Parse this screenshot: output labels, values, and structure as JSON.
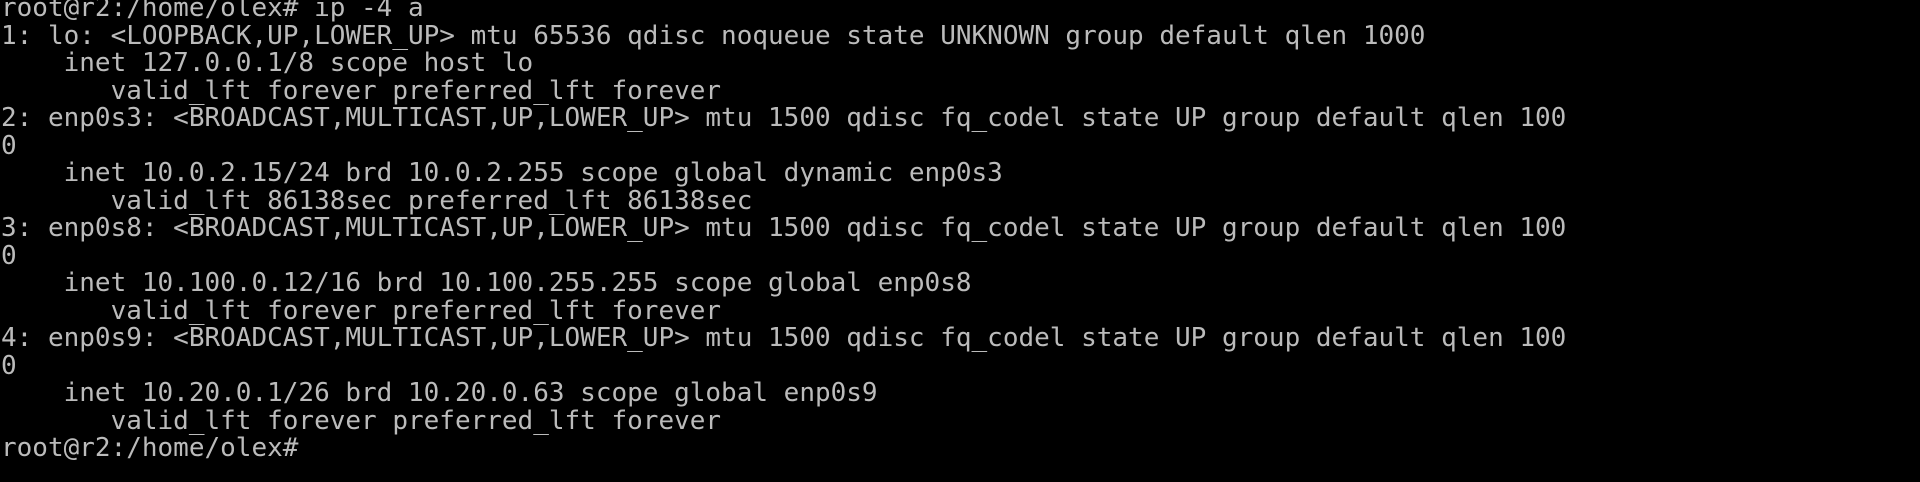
{
  "terminal": {
    "colors": {
      "background": "#000000",
      "foreground": "#bbbbbb"
    },
    "lines": [
      "root@r2:/home/olex# ip -4 a",
      "1: lo: <LOOPBACK,UP,LOWER_UP> mtu 65536 qdisc noqueue state UNKNOWN group default qlen 1000",
      "    inet 127.0.0.1/8 scope host lo",
      "       valid_lft forever preferred_lft forever",
      "2: enp0s3: <BROADCAST,MULTICAST,UP,LOWER_UP> mtu 1500 qdisc fq_codel state UP group default qlen 100",
      "0",
      "    inet 10.0.2.15/24 brd 10.0.2.255 scope global dynamic enp0s3",
      "       valid_lft 86138sec preferred_lft 86138sec",
      "3: enp0s8: <BROADCAST,MULTICAST,UP,LOWER_UP> mtu 1500 qdisc fq_codel state UP group default qlen 100",
      "0",
      "    inet 10.100.0.12/16 brd 10.100.255.255 scope global enp0s8",
      "       valid_lft forever preferred_lft forever",
      "4: enp0s9: <BROADCAST,MULTICAST,UP,LOWER_UP> mtu 1500 qdisc fq_codel state UP group default qlen 100",
      "0",
      "    inet 10.20.0.1/26 brd 10.20.0.63 scope global enp0s9",
      "       valid_lft forever preferred_lft forever",
      "root@r2:/home/olex#"
    ]
  }
}
